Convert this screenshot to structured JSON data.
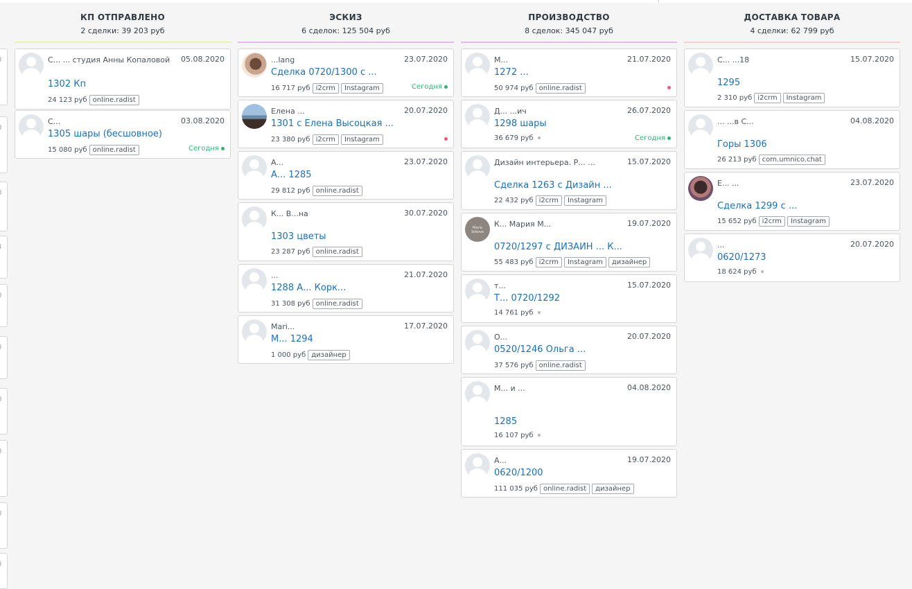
{
  "columns": [
    {
      "title": "КП ОТПРАВЛЕНО",
      "summary": "2 сделки: 39 203 руб",
      "line_color": "#e7f3a6",
      "cards": [
        {
          "contact": "С... ... студия Анны Копаловой",
          "date": "05.08.2020",
          "deal": "1302 Кп",
          "sum": "24 123 руб",
          "tags": [
            "online.radist"
          ]
        },
        {
          "contact": "С...",
          "date": "03.08.2020",
          "deal": "1305 шары (бесшовное)",
          "sum": "15 080 руб",
          "tags": [
            "online.radist"
          ],
          "status": "Сегодня"
        }
      ]
    },
    {
      "title": "ЭСКИЗ",
      "summary": "6 сделок: 125 504 руб",
      "line_color": "#e4b8ea",
      "cards": [
        {
          "contact": "...lang",
          "date": "23.07.2020",
          "deal": "Сделка 0720/1300 с ...",
          "sum": "16 717 руб",
          "tags": [
            "i2crm",
            "Instagram"
          ],
          "status": "Сегодня"
        },
        {
          "contact": "Елена ...",
          "date": "20.07.2020",
          "deal": "1301 с Елена Высоцкая ...",
          "sum": "23 380 руб",
          "tags": [
            "i2crm",
            "Instagram"
          ]
        },
        {
          "contact": "А...",
          "date": "23.07.2020",
          "deal": "А... 1285",
          "sum": "29 812 руб",
          "tags": [
            "online.radist"
          ]
        },
        {
          "contact": "К... В...на",
          "date": "30.07.2020",
          "deal": "1303 цветы",
          "sum": "23 287 руб",
          "tags": [
            "online.radist"
          ]
        },
        {
          "contact": "...",
          "date": "21.07.2020",
          "deal": "1288 А... Корк...",
          "sum": "31 308 руб",
          "tags": [
            "online.radist"
          ]
        },
        {
          "contact": "Mari...",
          "date": "17.07.2020",
          "deal": "М... 1294",
          "sum": "1 000 руб",
          "tags": [
            "дизайнер"
          ]
        }
      ]
    },
    {
      "title": "ПРОИЗВОДСТВО",
      "summary": "8 сделок: 345 047 руб",
      "line_color": "#e4b8ea",
      "cards": [
        {
          "contact": "М...",
          "date": "21.07.2020",
          "deal": "1272 ...",
          "sum": "50 974 руб",
          "tags": [
            "online.radist"
          ]
        },
        {
          "contact": "Д... ...ич",
          "date": "26.07.2020",
          "deal": "1298 шары",
          "sum": "36 679 руб",
          "tags": [],
          "status": "Сегодня"
        },
        {
          "contact": "Дизайн интерьера. Р... ...",
          "date": "15.07.2020",
          "deal": "Сделка 1263 с Дизайн ...",
          "sum": "22 432 руб",
          "tags": [
            "i2crm",
            "Instagram"
          ]
        },
        {
          "contact": "К... Мария М...",
          "date": "19.07.2020",
          "deal": "0720/1297 с ДИЗАЙН ... К...",
          "sum": "55 483 руб",
          "tags": [
            "i2crm",
            "Instagram",
            "дизайнер"
          ]
        },
        {
          "contact": "т...",
          "date": "15.07.2020",
          "deal": "Т... 0720/1292",
          "sum": "14 761 руб",
          "tags": []
        },
        {
          "contact": "О...",
          "date": "20.07.2020",
          "deal": "0520/1246 Ольга ...",
          "sum": "37 576 руб",
          "tags": [
            "online.radist"
          ]
        },
        {
          "contact": "М... и ...",
          "date": "04.08.2020",
          "deal": "1285",
          "sum": "16 107 руб",
          "tags": []
        },
        {
          "contact": "А...",
          "date": "19.07.2020",
          "deal": "0620/1200",
          "sum": "111 035 руб",
          "tags": [
            "online.radist",
            "дизайнер"
          ]
        }
      ]
    },
    {
      "title": "ДОСТАВКА ТОВАРА",
      "summary": "4 сделки: 62 799 руб",
      "line_color": "#f7cfcf",
      "cards": [
        {
          "contact": "С... ...18",
          "date": "15.07.2020",
          "deal": "1295",
          "sum": "2 310 руб",
          "tags": [
            "i2crm",
            "Instagram"
          ]
        },
        {
          "contact": "... ...в С...",
          "date": "04.08.2020",
          "deal": "Горы 1306",
          "sum": "26 213 руб",
          "tags": [
            "com.umnico.chat"
          ]
        },
        {
          "contact": "Е... ...",
          "date": "23.07.2020",
          "deal": "Сделка 1299 с ...",
          "sum": "15 652 руб",
          "tags": [
            "i2crm",
            "Instagram"
          ]
        },
        {
          "contact": "...",
          "date": "20.07.2020",
          "deal": "0620/1273",
          "sum": "18 624 руб",
          "tags": []
        }
      ]
    }
  ],
  "colors": {
    "link": "#1b6fba",
    "today": "#2ab571",
    "alert_dot": "#f25a7b"
  }
}
